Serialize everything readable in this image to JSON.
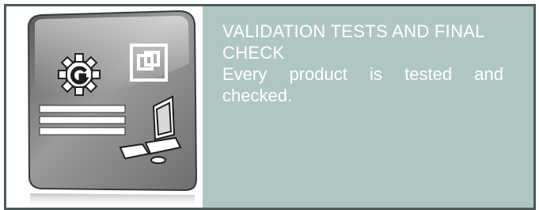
{
  "card": {
    "title": "VALIDATION TESTS AND FINAL CHECK",
    "description": "Every product is tested and checked."
  },
  "icons": {
    "main": "validation-graphic-icon",
    "gear": "gear-icon",
    "window": "window-icon",
    "list": "list-lines-icon",
    "computer": "desktop-computer-icon"
  },
  "colors": {
    "border": "#4c5a58",
    "panel": "#b0c6c3",
    "text": "#ffffff",
    "tile": "#7a7a7a"
  }
}
